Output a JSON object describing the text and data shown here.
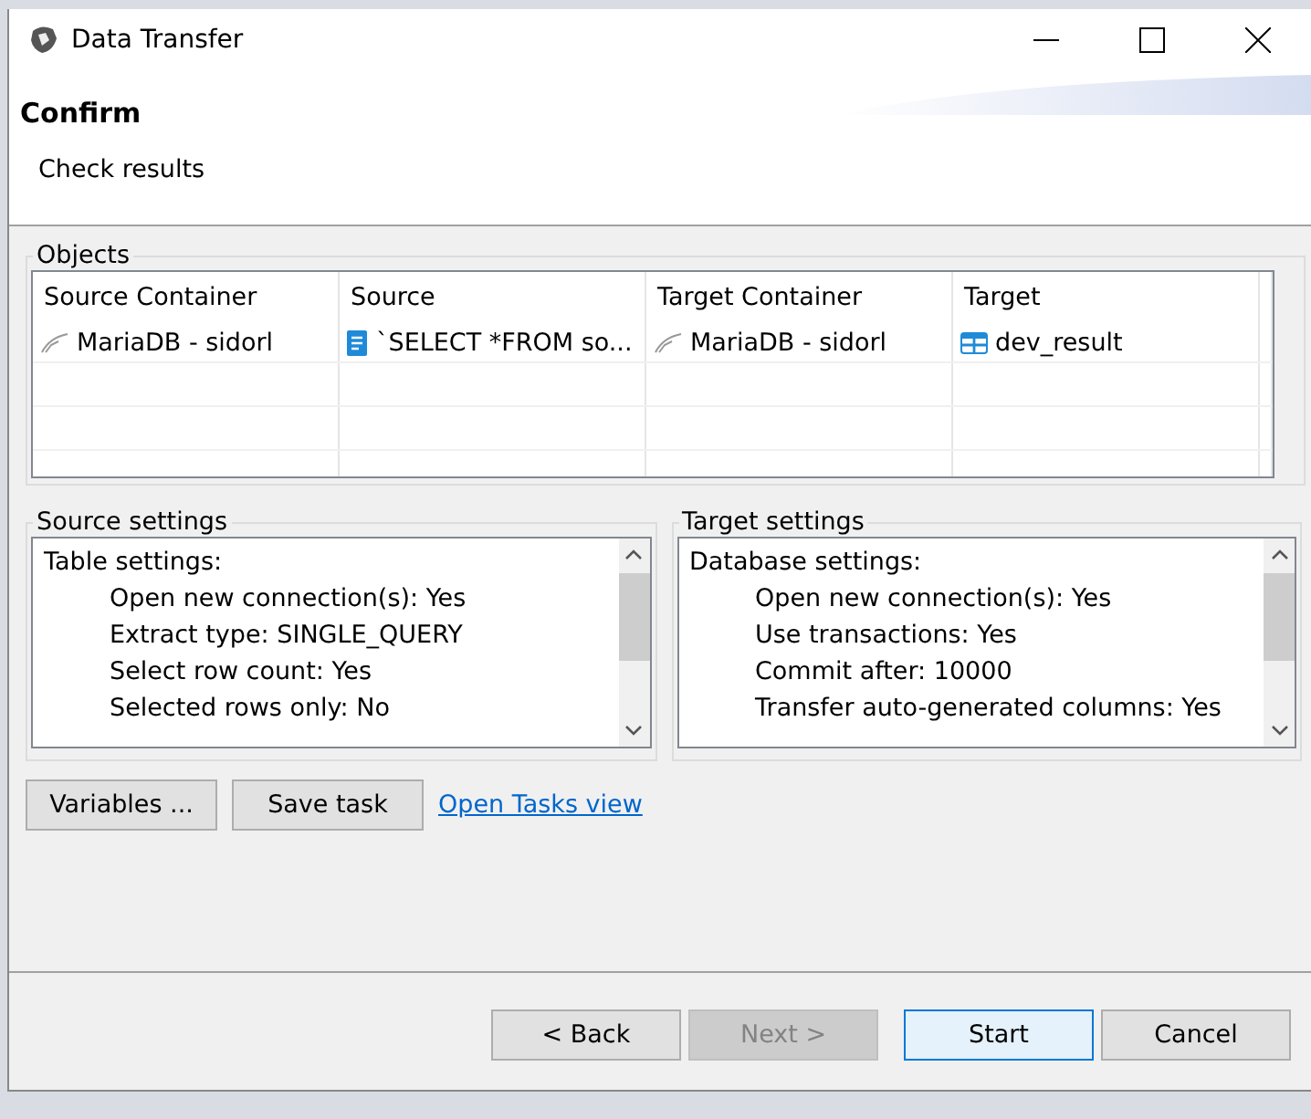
{
  "window": {
    "title": "Data Transfer"
  },
  "header": {
    "title": "Confirm",
    "subtitle": "Check results"
  },
  "objects": {
    "label": "Objects",
    "columns": [
      "Source Container",
      "Source",
      "Target Container",
      "Target"
    ],
    "rows": [
      {
        "cells": [
          {
            "text": "MariaDB - sidorl",
            "kind": "connection"
          },
          {
            "text": "`SELECT *FROM so...",
            "kind": "script"
          },
          {
            "text": "MariaDB - sidorl",
            "kind": "connection"
          },
          {
            "text": "dev_result",
            "kind": "table"
          }
        ]
      }
    ]
  },
  "settings": [
    {
      "label": "Source settings",
      "heading": "Table settings:",
      "items": [
        "Open new connection(s): Yes",
        "Extract type: SINGLE_QUERY",
        "Select row count: Yes",
        "Selected rows only: No"
      ]
    },
    {
      "label": "Target settings",
      "heading": "Database settings:",
      "items": [
        "Open new connection(s): Yes",
        "Use transactions: Yes",
        "Commit after: 10000",
        "Transfer auto-generated columns: Yes"
      ]
    }
  ],
  "actions": [
    {
      "kind": "button",
      "label": "Variables ..."
    },
    {
      "kind": "button",
      "label": "Save task"
    },
    {
      "kind": "link",
      "label": "Open Tasks view"
    }
  ],
  "footer": [
    {
      "label": "< Back",
      "disabled": false,
      "default": false
    },
    {
      "label": "Next >",
      "disabled": true,
      "default": false
    },
    {
      "label": "Start",
      "disabled": false,
      "default": true
    },
    {
      "label": "Cancel",
      "disabled": false,
      "default": false
    }
  ]
}
